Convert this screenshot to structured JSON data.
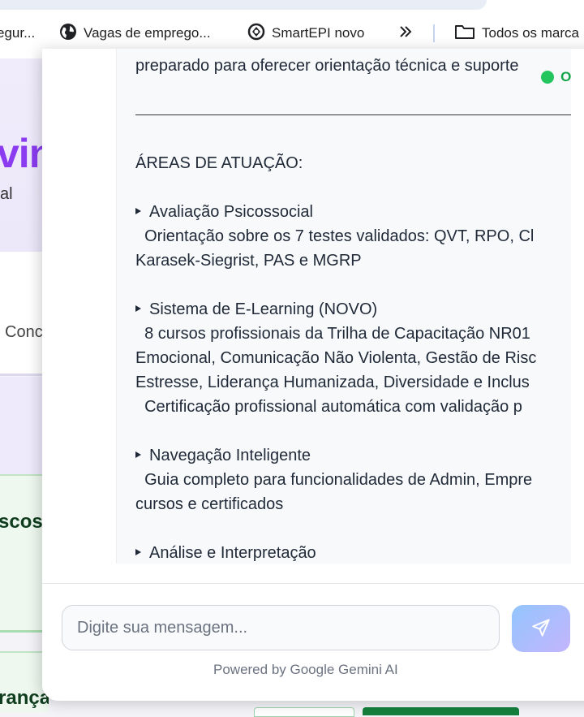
{
  "bookmarks": {
    "items": [
      {
        "label": "egur...",
        "icon": "page-icon"
      },
      {
        "label": "Vagas de emprego...",
        "icon": "globe-icon"
      },
      {
        "label": "SmartEPI novo",
        "icon": "smartepi-icon"
      }
    ],
    "overflow_icon": "double-chevron-right-icon",
    "folder_label": "Todos os marca",
    "folder_icon": "folder-icon"
  },
  "background_page": {
    "hero_title_fragment": "vin",
    "hero_subtitle_fragment": "al",
    "card_text_fragment": "Conc",
    "green_card1_fragment": "scos",
    "green_card2_fragment": "rança"
  },
  "chat": {
    "status": "ONLIN",
    "message": {
      "intro_line": "preparado para oferecer orientação técnica e suporte",
      "section_title": "ÁREAS DE ATUAÇÃO:",
      "areas": [
        {
          "title": "Avaliação Psicossocial",
          "lines": [
            "  Orientação sobre os 7 testes validados: QVT, RPO, Cl",
            "Karasek-Siegrist, PAS e MGRP"
          ]
        },
        {
          "title": "Sistema de E-Learning (NOVO)",
          "lines": [
            "  8 cursos profissionais da Trilha de Capacitação NR01",
            "Emocional, Comunicação Não Violenta, Gestão de Risc",
            "Estresse, Liderança Humanizada, Diversidade e Inclus",
            "  Certificação profissional automática com validação p"
          ]
        },
        {
          "title": "Navegação Inteligente",
          "lines": [
            "  Guia completo para funcionalidades de Admin, Empre",
            "cursos e certificados"
          ]
        },
        {
          "title": "Análise e Interpretação",
          "lines": []
        }
      ]
    },
    "input_placeholder": "Digite sua mensagem...",
    "send_icon": "send-icon",
    "powered_by": "Powered by Google Gemini AI"
  },
  "colors": {
    "accent_purple": "#8b3cf0",
    "online_green": "#16a34a",
    "send_gradient_start": "#93c5fd",
    "send_gradient_end": "#c4b5fd",
    "green_button": "#15803d"
  }
}
